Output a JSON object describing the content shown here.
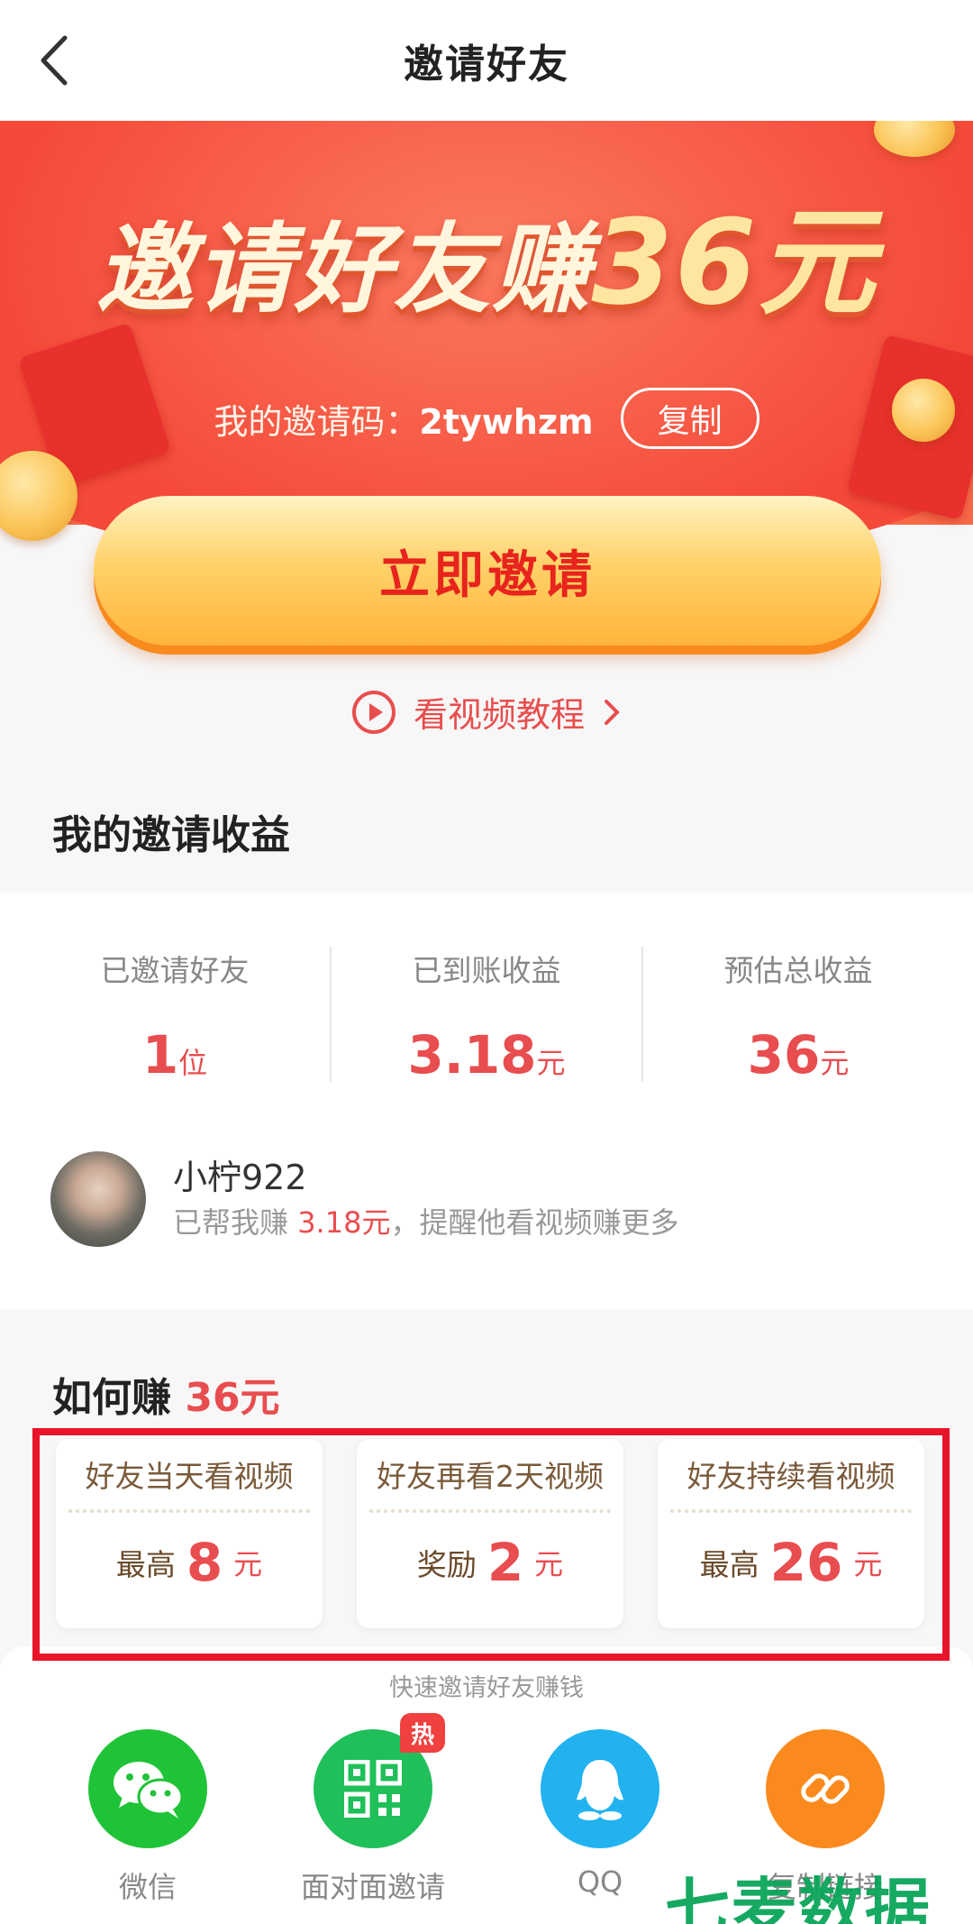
{
  "header": {
    "title": "邀请好友"
  },
  "banner": {
    "headline_text": "邀请好友赚",
    "headline_amount": "36元",
    "code_label": "我的邀请码：",
    "code_value": "2tywhzm",
    "copy_label": "复制",
    "invite_label": "立即邀请",
    "tutorial_label": "看视频教程"
  },
  "earnings": {
    "title": "我的邀请收益",
    "stats": [
      {
        "label": "已邀请好友",
        "value": "1",
        "unit": "位"
      },
      {
        "label": "已到账收益",
        "value": "3.18",
        "unit": "元"
      },
      {
        "label": "预估总收益",
        "value": "36",
        "unit": "元"
      }
    ],
    "friend": {
      "name": "小柠922",
      "desc_prefix": "已帮我赚 ",
      "desc_amount": "3.18元",
      "desc_suffix": "，提醒他看视频赚更多"
    }
  },
  "how": {
    "title": "如何赚",
    "amount": "36元",
    "steps": [
      {
        "title": "好友当天看视频",
        "prefix": "最高",
        "value": "8",
        "unit": "元"
      },
      {
        "title": "好友再看2天视频",
        "prefix": "奖励",
        "value": "2",
        "unit": "元"
      },
      {
        "title": "好友持续看视频",
        "prefix": "最高",
        "value": "26",
        "unit": "元"
      }
    ]
  },
  "share": {
    "title": "快速邀请好友赚钱",
    "items": [
      {
        "label": "微信",
        "icon": "wechat-icon",
        "color": "#1fc337"
      },
      {
        "label": "面对面邀请",
        "icon": "qrcode-icon",
        "color": "#1fbf5a",
        "badge": "热"
      },
      {
        "label": "QQ",
        "icon": "qq-icon",
        "color": "#22b2f0"
      },
      {
        "label": "复制链接",
        "icon": "link-icon",
        "color": "#fa8a1e"
      }
    ]
  },
  "watermark": "七麦数据",
  "colors": {
    "accent": "#e84d4f",
    "banner_red": "#f54a3a",
    "button_yellow": "#ffd26a",
    "highlight_frame": "#e8152a"
  }
}
